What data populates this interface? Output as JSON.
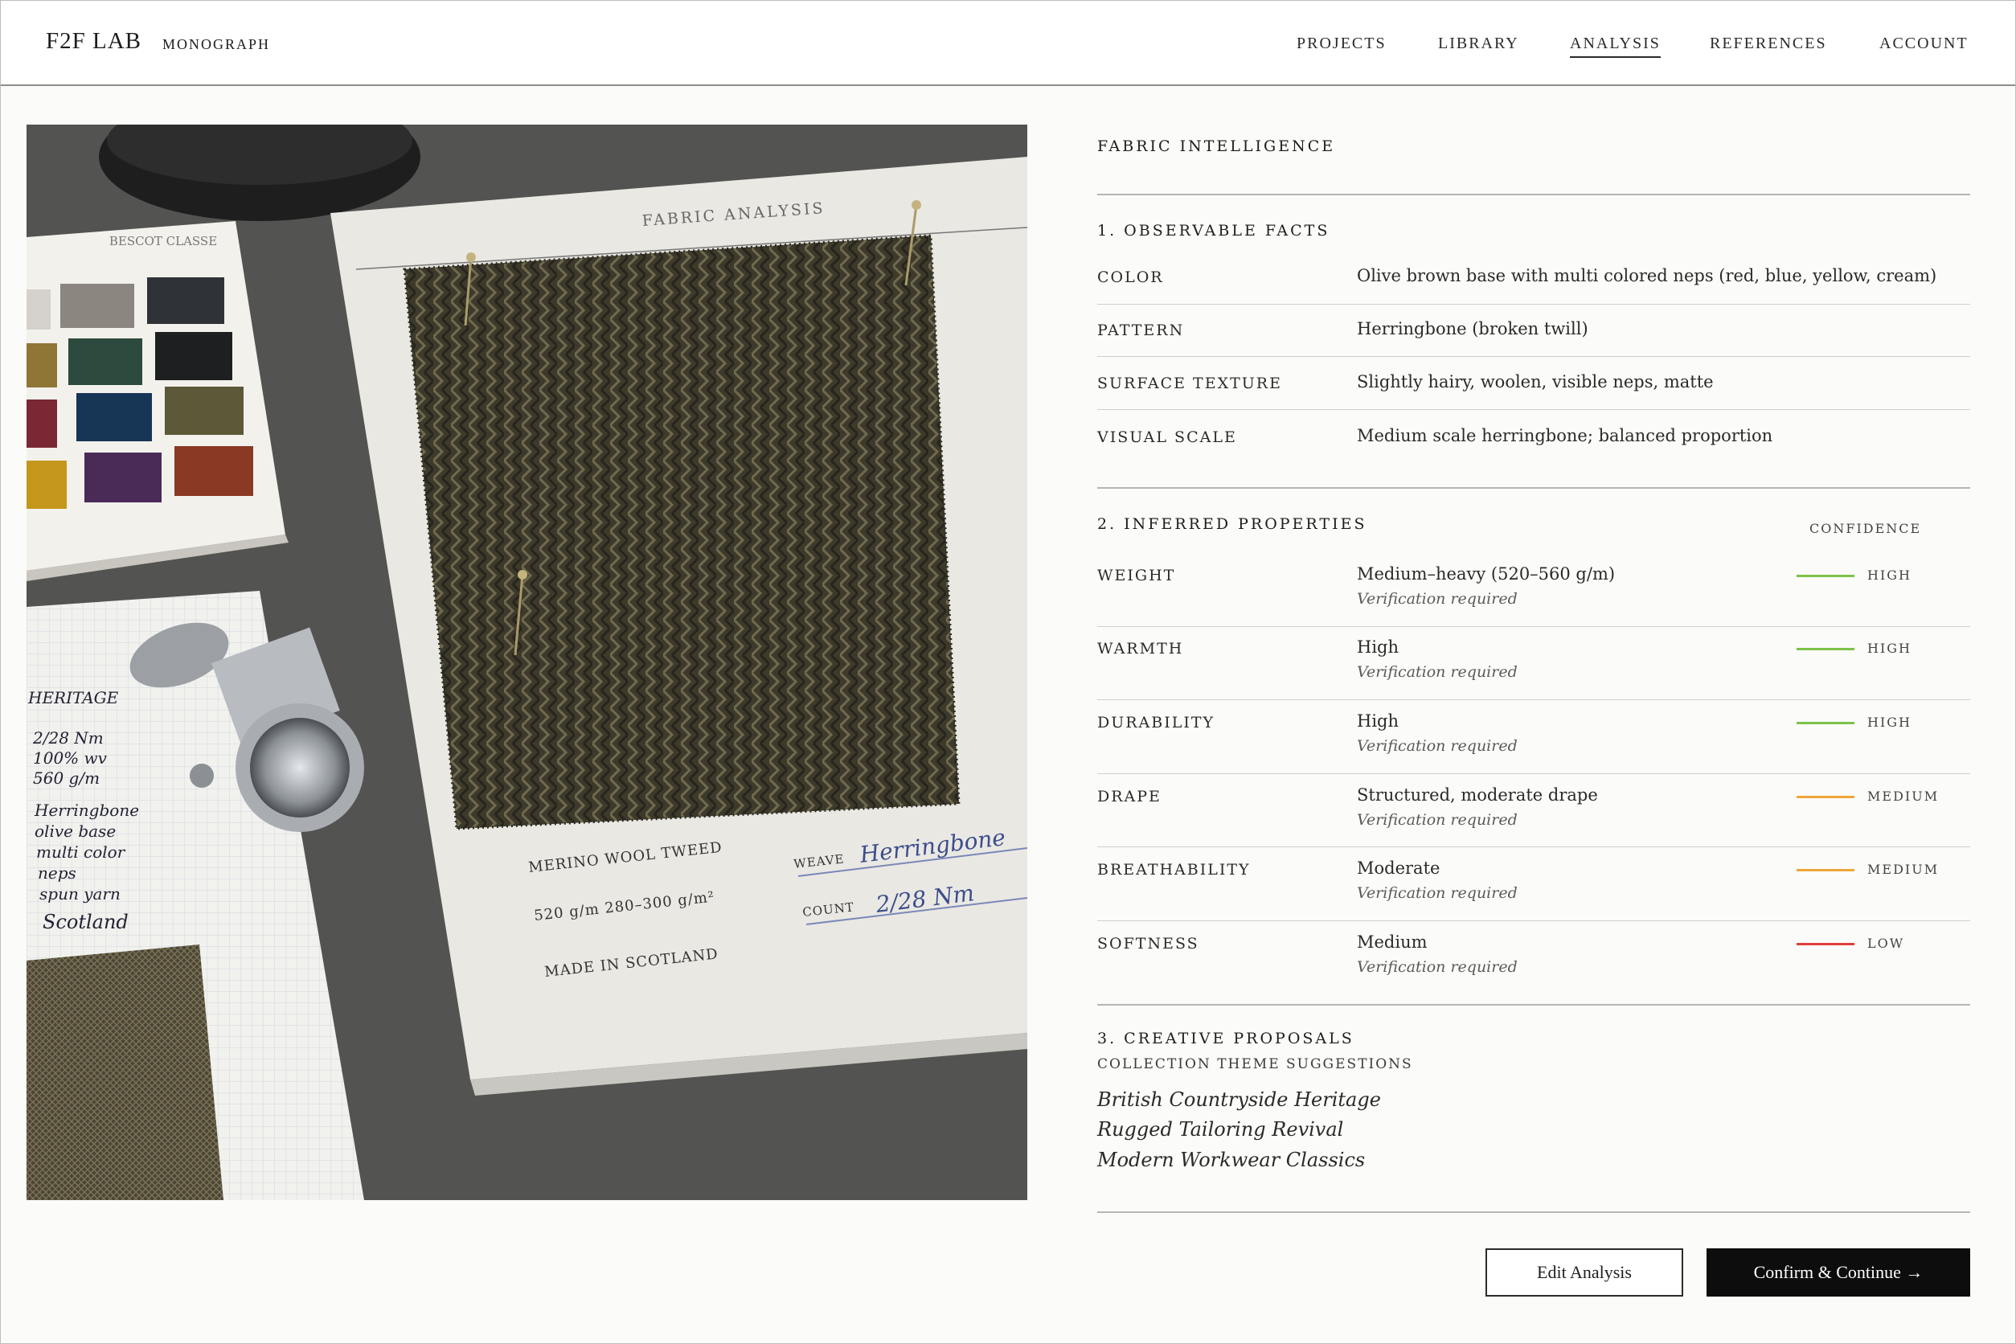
{
  "header": {
    "brand": "F2F LAB",
    "brand_sub": "MONOGRAPH",
    "nav": [
      {
        "label": "PROJECTS",
        "active": false
      },
      {
        "label": "LIBRARY",
        "active": false
      },
      {
        "label": "ANALYSIS",
        "active": true
      },
      {
        "label": "REFERENCES",
        "active": false
      },
      {
        "label": "ACCOUNT",
        "active": false
      }
    ]
  },
  "photo": {
    "card_title": "FABRIC ANALYSIS",
    "card_lines": [
      "MERINO WOOL TWEED",
      "520 g/m   280–300 g/m²",
      "MADE IN SCOTLAND"
    ],
    "weave_label": "WEAVE",
    "weave_value": "Herringbone",
    "count_label": "COUNT",
    "count_value": "2/28 Nm",
    "swatch_book_title": "BESCOT CLASSE",
    "notebook_lines": [
      "HERITAGE",
      "2/28 Nm",
      "100% wv",
      "560 g/m",
      "Herringbone",
      "olive base",
      "multi color",
      "neps",
      "spun yarn",
      "Scotland"
    ]
  },
  "panel": {
    "eyebrow": "FABRIC INTELLIGENCE",
    "observable": {
      "title": "1. OBSERVABLE FACTS",
      "rows": [
        {
          "label": "COLOR",
          "value": "Olive brown base with multi colored neps (red, blue, yellow, cream)"
        },
        {
          "label": "PATTERN",
          "value": "Herringbone (broken twill)"
        },
        {
          "label": "SURFACE TEXTURE",
          "value": "Slightly hairy, woolen, visible neps, matte"
        },
        {
          "label": "VISUAL SCALE",
          "value": "Medium scale herringbone; balanced proportion"
        }
      ]
    },
    "inferred": {
      "title": "2. INFERRED PROPERTIES",
      "confidence_header": "CONFIDENCE",
      "rows": [
        {
          "label": "WEIGHT",
          "value": "Medium–heavy (520–560 g/m)",
          "note": "Verification required",
          "confidence": "HIGH",
          "color": "#7cc24a"
        },
        {
          "label": "WARMTH",
          "value": "High",
          "note": "Verification required",
          "confidence": "HIGH",
          "color": "#7cc24a"
        },
        {
          "label": "DURABILITY",
          "value": "High",
          "note": "Verification required",
          "confidence": "HIGH",
          "color": "#7cc24a"
        },
        {
          "label": "DRAPE",
          "value": "Structured, moderate drape",
          "note": "Verification required",
          "confidence": "MEDIUM",
          "color": "#f0a63a"
        },
        {
          "label": "BREATHABILITY",
          "value": "Moderate",
          "note": "Verification required",
          "confidence": "MEDIUM",
          "color": "#f0a63a"
        },
        {
          "label": "SOFTNESS",
          "value": "Medium",
          "note": "Verification required",
          "confidence": "LOW",
          "color": "#e0413a"
        }
      ]
    },
    "creative": {
      "title": "3. CREATIVE PROPOSALS",
      "subtitle": "COLLECTION THEME SUGGESTIONS",
      "themes": [
        "British Countryside Heritage",
        "Rugged Tailoring Revival",
        "Modern Workwear Classics"
      ]
    },
    "actions": {
      "edit": "Edit Analysis",
      "confirm": "Confirm & Continue →"
    }
  }
}
